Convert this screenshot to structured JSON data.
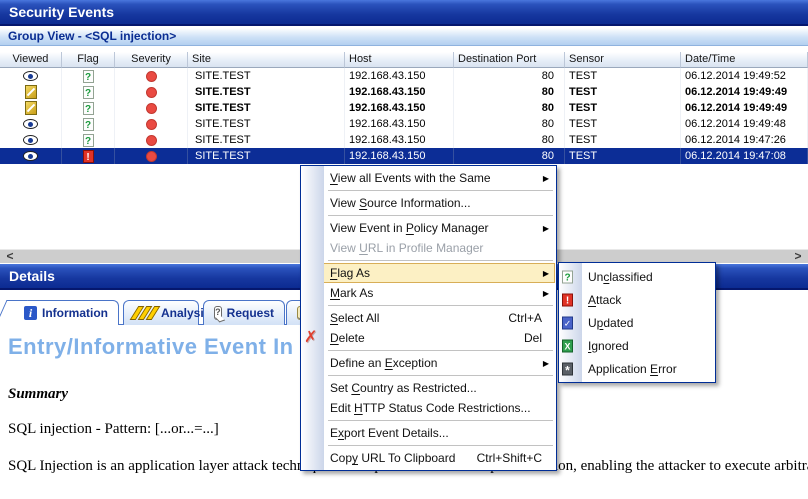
{
  "window": {
    "title": "Security Events",
    "group_bar": "Group View - <SQL injection>",
    "details_title": "Details"
  },
  "table": {
    "columns": [
      "Viewed",
      "Flag",
      "Severity",
      "Site",
      "Host",
      "Destination Port",
      "Sensor",
      "Date/Time"
    ],
    "rows": [
      {
        "viewed_icon": "eye",
        "flag_icon": "unclassified",
        "severity_icon": "high",
        "site": "SITE.TEST",
        "host": "192.168.43.150",
        "port": "80",
        "sensor": "TEST",
        "datetime": "06.12.2014 19:49:52",
        "bold": false,
        "selected": false
      },
      {
        "viewed_icon": "pen",
        "flag_icon": "unclassified",
        "severity_icon": "high",
        "site": "SITE.TEST",
        "host": "192.168.43.150",
        "port": "80",
        "sensor": "TEST",
        "datetime": "06.12.2014 19:49:49",
        "bold": true,
        "selected": false
      },
      {
        "viewed_icon": "pen",
        "flag_icon": "unclassified",
        "severity_icon": "high",
        "site": "SITE.TEST",
        "host": "192.168.43.150",
        "port": "80",
        "sensor": "TEST",
        "datetime": "06.12.2014 19:49:49",
        "bold": true,
        "selected": false
      },
      {
        "viewed_icon": "eye",
        "flag_icon": "unclassified",
        "severity_icon": "high",
        "site": "SITE.TEST",
        "host": "192.168.43.150",
        "port": "80",
        "sensor": "TEST",
        "datetime": "06.12.2014 19:49:48",
        "bold": false,
        "selected": false
      },
      {
        "viewed_icon": "eye",
        "flag_icon": "unclassified",
        "severity_icon": "high",
        "site": "SITE.TEST",
        "host": "192.168.43.150",
        "port": "80",
        "sensor": "TEST",
        "datetime": "06.12.2014 19:47:26",
        "bold": false,
        "selected": false
      },
      {
        "viewed_icon": "eye",
        "flag_icon": "attack",
        "severity_icon": "high",
        "site": "SITE.TEST",
        "host": "192.168.43.150",
        "port": "80",
        "sensor": "TEST",
        "datetime": "06.12.2014 19:47:08",
        "bold": false,
        "selected": true
      }
    ]
  },
  "scrollbar": {
    "left_glyph": "<",
    "right_glyph": ">"
  },
  "tabs": [
    {
      "label": "Information",
      "icon": "info",
      "active": true
    },
    {
      "label": "Analysis",
      "icon": "lightning",
      "active": false
    },
    {
      "label": "Request",
      "icon": "question-bubble",
      "active": false
    },
    {
      "label": "",
      "icon": "pale-bubble",
      "active": false,
      "partial": true
    }
  ],
  "details": {
    "heading": "Entry/Informative Event In",
    "summary_label": "Summary",
    "pattern_line": "SQL injection - Pattern: [...or...=...]",
    "body_line": "SQL Injection is an application layer attack technique that exploits the lack of input validation, enabling the attacker to execute arbitra"
  },
  "context_menu": {
    "items": [
      {
        "label": "&View all Events with the Same",
        "submenu": true
      },
      {
        "sep": true
      },
      {
        "label": "View &Source Information..."
      },
      {
        "sep": true
      },
      {
        "label": "View Event in &Policy Manager",
        "submenu": true
      },
      {
        "label": "View &URL in Profile Manager",
        "disabled": true
      },
      {
        "sep": true
      },
      {
        "label": "&Flag As",
        "submenu": true,
        "highlight": true
      },
      {
        "label": "&Mark As",
        "submenu": true
      },
      {
        "sep": true
      },
      {
        "label": "&Select All",
        "shortcut": "Ctrl+A"
      },
      {
        "label": "&Delete",
        "shortcut": "Del",
        "icon": "delete-x"
      },
      {
        "sep": true
      },
      {
        "label": "Define an &Exception",
        "submenu": true
      },
      {
        "sep": true
      },
      {
        "label": "Set &Country as Restricted..."
      },
      {
        "label": "Edit &HTTP Status Code Restrictions..."
      },
      {
        "sep": true
      },
      {
        "label": "E&xport Event Details..."
      },
      {
        "sep": true
      },
      {
        "label": "Cop&y URL To Clipboard",
        "shortcut": "Ctrl+Shift+C"
      }
    ]
  },
  "flag_submenu": {
    "items": [
      {
        "label": "Un&classified",
        "icon": "flag-unclassified"
      },
      {
        "label": "&Attack",
        "icon": "flag-attack"
      },
      {
        "label": "U&pdated",
        "icon": "flag-updated"
      },
      {
        "label": "&Ignored",
        "icon": "flag-ignored"
      },
      {
        "label": "Application &Error",
        "icon": "flag-application-error"
      }
    ]
  },
  "colors": {
    "titlebar_top": "#4a77dd",
    "titlebar_bottom": "#0c2b92",
    "selection": "#0c2d96",
    "severity_dot": "#ea4a42",
    "menu_highlight": "#fcf0c4",
    "heading_blue": "#7fb0e8",
    "attack_red": "#e03226",
    "unclassified_green": "#1a9a3c"
  }
}
